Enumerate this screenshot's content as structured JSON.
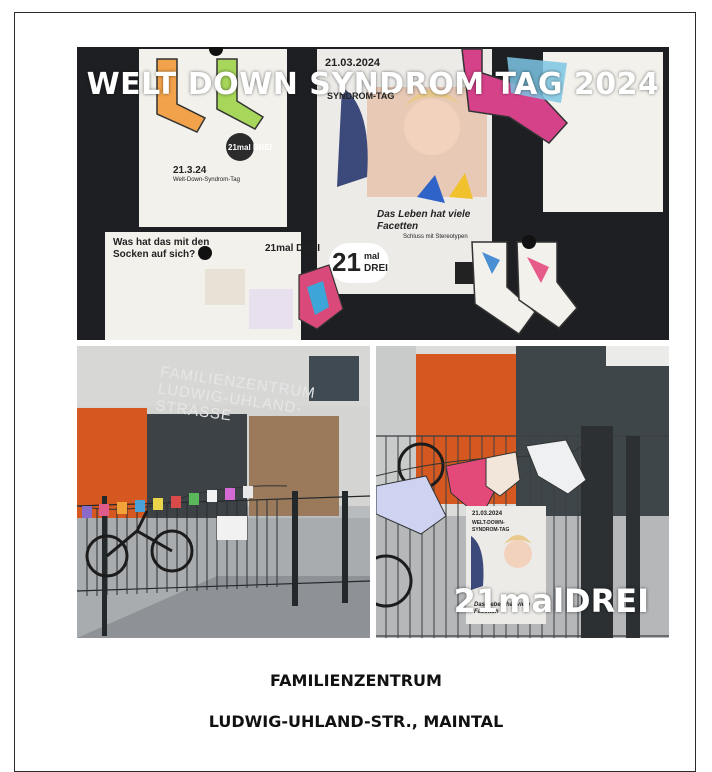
{
  "photo_top": {
    "overlay_title": "WELT DOWN SYNDROM TAG 2024",
    "poster_main": {
      "date": "21.03.2024",
      "line1": "WELT-DOWN-",
      "line2": "SYNDROM-TAG",
      "slogan": "Das Leben hat viele Facetten",
      "subline": "Schluss mit Stereotypen",
      "brand_num": "21",
      "brand_mal": "mal",
      "brand_drei": "DREI"
    },
    "poster_left": {
      "date": "21.3.24",
      "line": "Welt-Down-Syndrom-Tag",
      "brand": "21mal DREI"
    },
    "poster_socks": {
      "heading": "Was hat das mit den Socken auf sich?",
      "brand": "21mal DREI"
    }
  },
  "photo_bottom_left": {
    "building_sign": "FAMILIENZENTRUM LUDWIG-UHLAND-STRASSE"
  },
  "photo_bottom_right": {
    "overlay_brand": "21malDREI",
    "poster_date": "21.03.2024",
    "poster_line1": "WELT-DOWN-",
    "poster_line2": "SYNDROM-TAG",
    "poster_slogan": "Das Leben hat viele Facetten"
  },
  "caption": {
    "line1": "FAMILIENZENTRUM",
    "line2": "LUDWIG-UHLAND-STR., MAINTAL"
  },
  "colors": {
    "board": "#1d1f22",
    "facade_orange": "#d4581f",
    "fence": "#2f3437",
    "wall": "#d9d9d6"
  }
}
